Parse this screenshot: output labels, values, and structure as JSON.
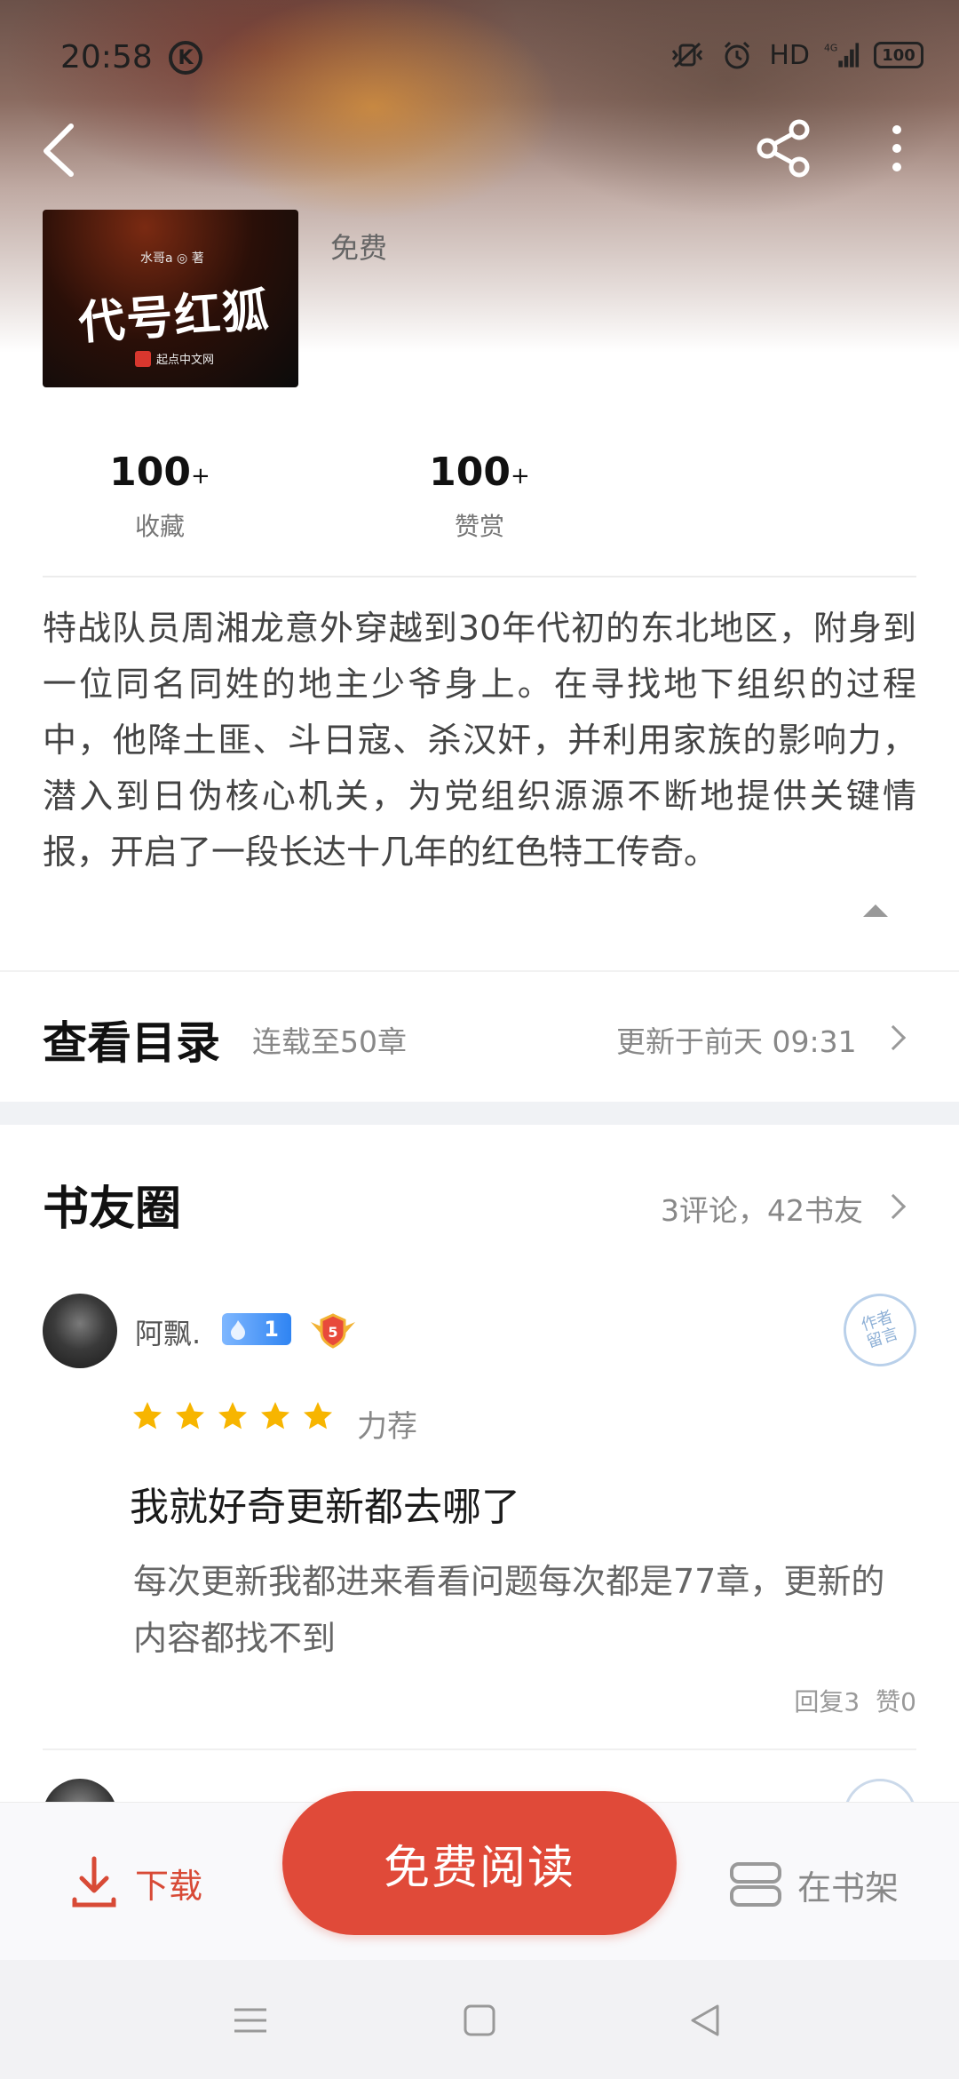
{
  "status_bar": {
    "time": "20:58",
    "k_badge": "K",
    "hd": "HD",
    "signal": "4G",
    "battery": "100"
  },
  "book": {
    "cover_author": "水哥a ◎ 著",
    "cover_title": "代号红狐",
    "cover_publisher": "起点中文网",
    "price": "免费"
  },
  "stats": {
    "favorites_value": "100",
    "favorites_suffix": "+",
    "favorites_label": "收藏",
    "rewards_value": "100",
    "rewards_suffix": "+",
    "rewards_label": "赞赏"
  },
  "description": "特战队员周湘龙意外穿越到30年代初的东北地区，附身到一位同名同姓的地主少爷身上。在寻找地下组织的过程中，他降土匪、斗日寇、杀汉奸，并利用家族的影响力，潜入到日伪核心机关，为党组织源源不断地提供关键情报，开启了一段长达十几年的红色特工传奇。",
  "catalog": {
    "title": "查看目录",
    "status": "连载至50章",
    "updated": "更新于前天 09:31"
  },
  "circle": {
    "title": "书友圈",
    "stats": "3评论，42书友"
  },
  "review": {
    "username": "阿飘.",
    "fan_level": "1",
    "user_level": "5",
    "stamp_text": "作者\n留言",
    "rating": 5,
    "rating_text": "力荐",
    "title": "我就好奇更新都去哪了",
    "body": "每次更新我都进来看看问题每次都是77章，更新的内容都找不到",
    "replies": "回复3",
    "likes": "赞0"
  },
  "actions": {
    "download": "下载",
    "read": "免费阅读",
    "shelf": "在书架"
  },
  "colors": {
    "accent": "#e04a39",
    "download": "#d84a36",
    "star": "#f7b500",
    "fan_badge": "#2f84f2"
  }
}
